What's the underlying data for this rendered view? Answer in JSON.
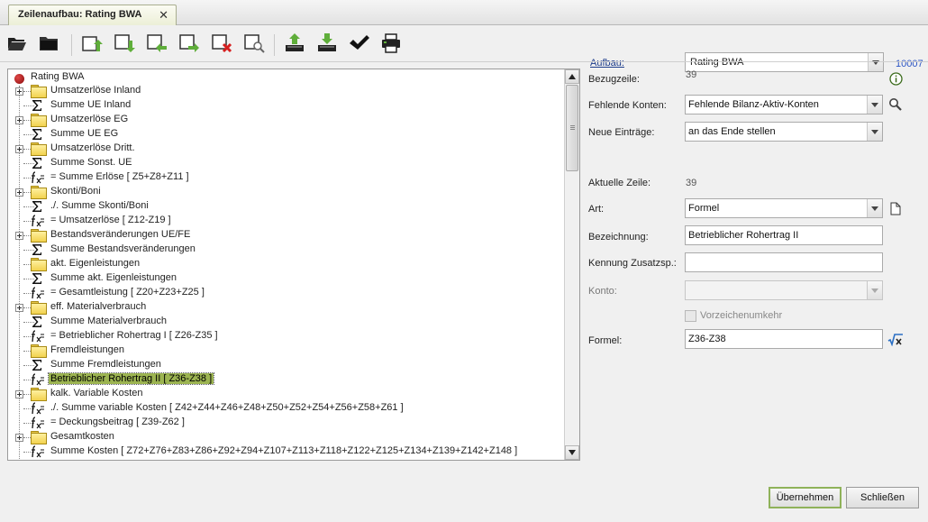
{
  "tab": {
    "title": "Zeilenaufbau: Rating BWA",
    "close": "✕"
  },
  "header": {
    "aufbau_label": "Aufbau:",
    "aufbau_value": "Rating BWA",
    "aufbau_id": "10007"
  },
  "tree": {
    "root": "Rating BWA",
    "items": [
      {
        "type": "folder",
        "label": "Umsatzerlöse Inland",
        "expandable": true
      },
      {
        "type": "sum",
        "label": "Summe UE Inland",
        "expandable": false
      },
      {
        "type": "folder",
        "label": "Umsatzerlöse EG",
        "expandable": true
      },
      {
        "type": "sum",
        "label": "Summe UE EG",
        "expandable": false
      },
      {
        "type": "folder",
        "label": "Umsatzerlöse Dritt.",
        "expandable": true
      },
      {
        "type": "sum",
        "label": "Summe Sonst. UE",
        "expandable": false
      },
      {
        "type": "formula",
        "label": "= Summe Erlöse [ Z5+Z8+Z11 ]",
        "expandable": false
      },
      {
        "type": "folder",
        "label": "Skonti/Boni",
        "expandable": true
      },
      {
        "type": "sum",
        "label": "./. Summe Skonti/Boni",
        "expandable": false
      },
      {
        "type": "formula",
        "label": "= Umsatzerlöse [ Z12-Z19 ]",
        "expandable": false
      },
      {
        "type": "folder",
        "label": "Bestandsveränderungen UE/FE",
        "expandable": true
      },
      {
        "type": "sum",
        "label": "Summe Bestandsveränderungen",
        "expandable": false
      },
      {
        "type": "folder",
        "label": "akt. Eigenleistungen",
        "expandable": false
      },
      {
        "type": "sum",
        "label": "Summe akt. Eigenleistungen",
        "expandable": false
      },
      {
        "type": "formula",
        "label": "= Gesamtleistung [ Z20+Z23+Z25 ]",
        "expandable": false
      },
      {
        "type": "folder",
        "label": "eff. Materialverbrauch",
        "expandable": true
      },
      {
        "type": "sum",
        "label": "Summe Materialverbrauch",
        "expandable": false
      },
      {
        "type": "formula",
        "label": "= Betrieblicher Rohertrag I [ Z26-Z35 ]",
        "expandable": false
      },
      {
        "type": "folder",
        "label": "Fremdleistungen",
        "expandable": false
      },
      {
        "type": "sum",
        "label": "Summe Fremdleistungen",
        "expandable": false
      },
      {
        "type": "formula",
        "label": "Betrieblicher Rohertrag II [ Z36-Z38 ]",
        "expandable": false,
        "selected": true
      },
      {
        "type": "folder",
        "label": "kalk. Variable Kosten",
        "expandable": true
      },
      {
        "type": "formula",
        "label": "./. Summe variable Kosten [ Z42+Z44+Z46+Z48+Z50+Z52+Z54+Z56+Z58+Z61 ]",
        "expandable": false
      },
      {
        "type": "formula",
        "label": "= Deckungsbeitrag [ Z39-Z62 ]",
        "expandable": false
      },
      {
        "type": "folder",
        "label": "Gesamtkosten",
        "expandable": true
      },
      {
        "type": "formula",
        "label": "Summe Kosten [ Z72+Z76+Z83+Z86+Z92+Z94+Z107+Z113+Z118+Z122+Z125+Z134+Z139+Z142+Z148 ]",
        "expandable": false
      }
    ]
  },
  "form": {
    "bezugzeile_label": "Bezugzeile:",
    "bezugzeile_value": "39",
    "fehlende_konten_label": "Fehlende Konten:",
    "fehlende_konten_value": "Fehlende Bilanz-Aktiv-Konten",
    "neue_eintraege_label": "Neue Einträge:",
    "neue_eintraege_value": "an das Ende stellen",
    "aktuelle_zeile_label": "Aktuelle Zeile:",
    "aktuelle_zeile_value": "39",
    "art_label": "Art:",
    "art_value": "Formel",
    "bezeichnung_label": "Bezeichnung:",
    "bezeichnung_value": "Betrieblicher Rohertrag II",
    "kennung_label": "Kennung Zusatzsp.:",
    "kennung_value": "",
    "konto_label": "Konto:",
    "konto_value": "",
    "vorzeichen_label": "Vorzeichenumkehr",
    "formel_label": "Formel:",
    "formel_value": "Z36-Z38"
  },
  "buttons": {
    "ok": "Übernehmen",
    "close": "Schließen"
  }
}
